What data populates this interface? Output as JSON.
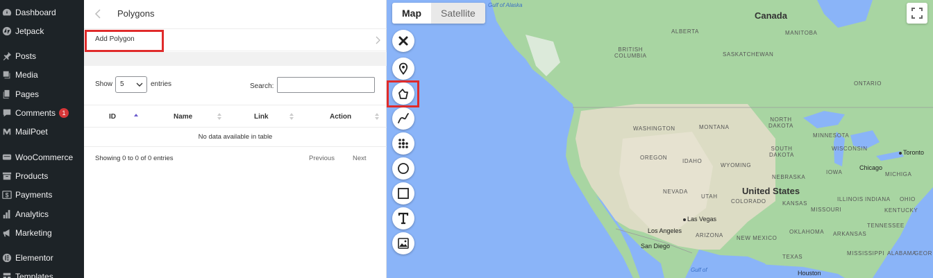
{
  "sidebar": {
    "items": [
      {
        "label": "Dashboard",
        "icon": "dashboard-icon"
      },
      {
        "label": "Jetpack",
        "icon": "jetpack-icon"
      },
      {
        "label": "Posts",
        "icon": "pin-icon"
      },
      {
        "label": "Media",
        "icon": "media-icon"
      },
      {
        "label": "Pages",
        "icon": "pages-icon"
      },
      {
        "label": "Comments",
        "icon": "comment-icon",
        "badge": "1"
      },
      {
        "label": "MailPoet",
        "icon": "mailpoet-icon"
      },
      {
        "label": "WooCommerce",
        "icon": "woocommerce-icon"
      },
      {
        "label": "Products",
        "icon": "archive-icon"
      },
      {
        "label": "Payments",
        "icon": "dollar-icon"
      },
      {
        "label": "Analytics",
        "icon": "bar-chart-icon"
      },
      {
        "label": "Marketing",
        "icon": "megaphone-icon"
      },
      {
        "label": "Elementor",
        "icon": "elementor-icon"
      },
      {
        "label": "Templates",
        "icon": "templates-icon"
      }
    ]
  },
  "panel": {
    "title": "Polygons",
    "add_polygon": "Add Polygon",
    "show_label": "Show",
    "entries_value": "5",
    "entries_label": "entries",
    "search_label": "Search:",
    "search_value": "",
    "table": {
      "columns": [
        "ID",
        "Name",
        "Link",
        "Action"
      ],
      "empty_message": "No data available in table"
    },
    "info": "Showing 0 to 0 of 0 entries",
    "previous": "Previous",
    "next": "Next"
  },
  "map": {
    "type_buttons": [
      "Map",
      "Satellite"
    ],
    "active_type": "Map",
    "tools": [
      "close-icon",
      "marker-icon",
      "polygon-icon",
      "polyline-icon",
      "dots-icon",
      "circle-icon",
      "rectangle-icon",
      "text-icon",
      "image-icon"
    ],
    "selected_tool": "polygon-icon",
    "labels": {
      "gulf": "Gulf of Alaska",
      "canada": "Canada",
      "alberta": "ALBERTA",
      "manitoba": "MANITOBA",
      "british_columbia": "BRITISH\nCOLUMBIA",
      "saskatchewan": "SASKATCHEWAN",
      "ontario": "ONTARIO",
      "washington": "WASHINGTON",
      "montana": "MONTANA",
      "north_dakota": "NORTH\nDAKOTA",
      "minnesota": "MINNESOTA",
      "oregon": "OREGON",
      "idaho": "IDAHO",
      "wyoming": "WYOMING",
      "south_dakota": "SOUTH\nDAKOTA",
      "wisconsin": "WISCONSIN",
      "toronto": "Toronto",
      "michigan": "MICHIGA",
      "chicago": "Chicago",
      "nebraska": "NEBRASKA",
      "iowa": "IOWA",
      "nevada": "NEVADA",
      "utah": "UTAH",
      "united_states": "United States",
      "colorado": "COLORADO",
      "illinois": "ILLINOIS",
      "indiana": "INDIANA",
      "ohio": "OHIO",
      "kansas": "KANSAS",
      "missouri": "MISSOURI",
      "kentucky": "KENTUCKY",
      "las_vegas": "Las Vegas",
      "los_angeles": "Los Angeles",
      "san_diego": "San Diego",
      "arizona": "ARIZONA",
      "new_mexico": "NEW MEXICO",
      "oklahoma": "OKLAHOMA",
      "arkansas": "ARKANSAS",
      "tennessee": "TENNESSEE",
      "mississippi": "MISSISSIPPI",
      "alabama": "ALABAMA",
      "texas": "TEXAS",
      "georgia": "GEOR",
      "houston": "Houston",
      "gulf_of_california": "Gulf of"
    }
  }
}
